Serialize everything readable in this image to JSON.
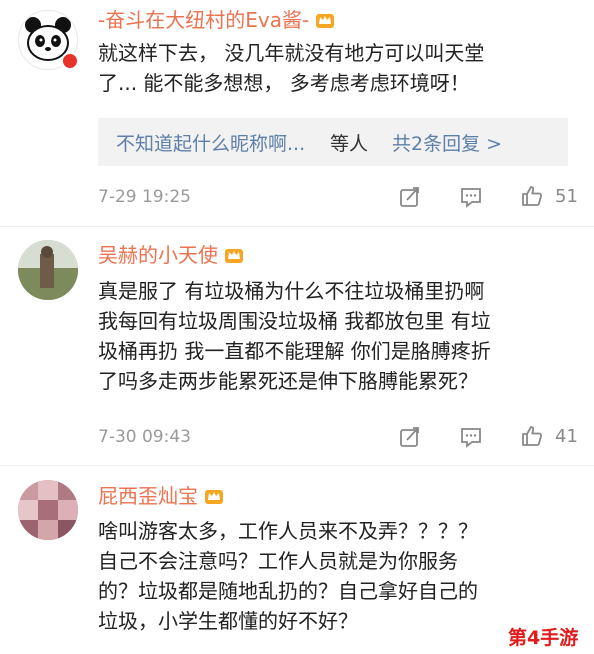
{
  "comments": [
    {
      "user": "-奋斗在大纽村的Eva酱-",
      "lines": [
        "就这样下去， 没几年就没有地方可以叫天堂",
        "了... 能不能多想想， 多考虑考虑环境呀！"
      ],
      "reply_nick": "不知道起什么昵称啊...",
      "reply_suffix": "等人",
      "reply_more": "共2条回复 >",
      "time": "7-29 19:25",
      "likes": "51"
    },
    {
      "user": "吴赫的小天使",
      "lines": [
        "真是服了 有垃圾桶为什么不往垃圾桶里扔啊",
        "我每回有垃圾周围没垃圾桶 我都放包里 有垃",
        "圾桶再扔 我一直都不能理解 你们是胳膊疼折",
        "了吗多走两步能累死还是伸下胳膊能累死？"
      ],
      "time": "7-30 09:43",
      "likes": "41"
    },
    {
      "user": "屁西歪灿宝",
      "lines": [
        "啥叫游客太多，工作人员来不及弄？？？？",
        "自己不会注意吗？工作人员就是为你服务",
        "的？垃圾都是随地乱扔的？自己拿好自己的",
        "垃圾，小学生都懂的好不好？"
      ]
    }
  ],
  "watermark": "第4手游",
  "colors": {
    "username": "#eb7350",
    "link": "#5d7fa8",
    "meta": "#9a9a9a",
    "badge": "#e8332a",
    "watermark": "#e21b1b"
  },
  "icons": [
    "panda-avatar",
    "crown-icon",
    "repost-icon",
    "comment-icon",
    "like-icon"
  ]
}
